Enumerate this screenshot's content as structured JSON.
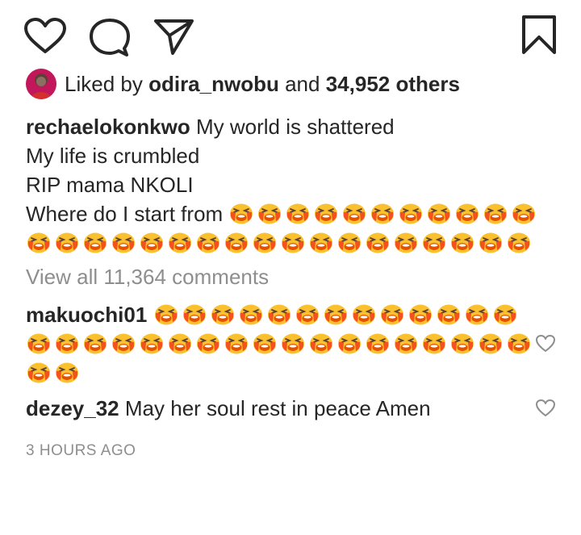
{
  "post": {
    "liked_by_prefix": "Liked by",
    "liked_by_user": "odira_nwobu",
    "liked_by_and": "and",
    "liked_by_others": "34,952 others",
    "caption": {
      "username": "rechaelokonkwo",
      "line1": "My world is shattered",
      "line2": "My life is crumbled",
      "line3": "RIP mama NKOLI",
      "line4": "Where do I start from",
      "emoji_name": "loudly-crying-face",
      "line4_emoji_count": 11,
      "line5_emoji_count": 18
    },
    "view_all": "View all 11,364 comments",
    "comments": [
      {
        "username": "makuochi01",
        "text": "",
        "emoji_name": "loudly-crying-face",
        "emoji_rows": [
          13,
          18,
          2
        ]
      },
      {
        "username": "dezey_32",
        "text": "May her soul rest in peace Amen"
      }
    ],
    "timestamp": "3 HOURS AGO"
  },
  "icons": {
    "like": "heart-outline-icon",
    "comment": "speech-bubble-icon",
    "share": "paper-plane-icon",
    "save": "bookmark-icon",
    "comment_like": "small-heart-icon"
  },
  "colors": {
    "text": "#262626",
    "muted": "#8e8e8e",
    "emoji_face": "#fbc02d",
    "emoji_mouth": "#e65100",
    "emoji_tears": "#f4511e"
  }
}
